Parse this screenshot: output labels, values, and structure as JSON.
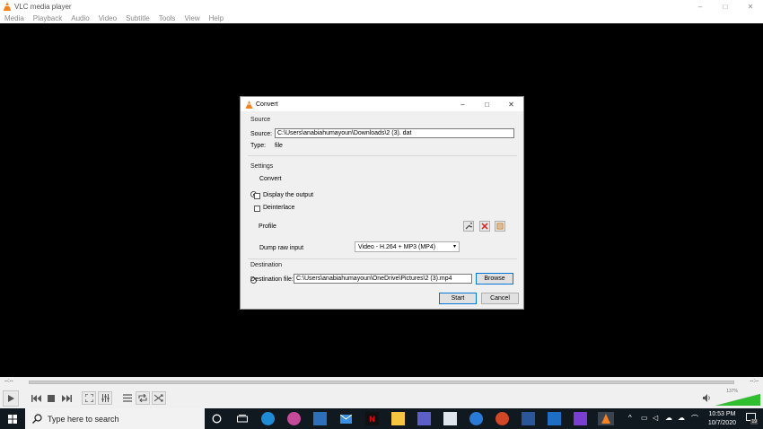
{
  "window": {
    "title": "VLC media player",
    "controls": [
      "–",
      "□",
      "✕"
    ]
  },
  "menu": [
    "Media",
    "Playback",
    "Audio",
    "Video",
    "Subtitle",
    "Tools",
    "View",
    "Help"
  ],
  "dialog": {
    "title": "Convert",
    "controls": [
      "–",
      "□",
      "✕"
    ],
    "source_section": "Source",
    "source_label": "Source:",
    "source_value": "C:\\Users\\anabiahumayoun\\Downloads\\2 (3). dat",
    "type_label": "Type:",
    "type_value": "file",
    "settings_section": "Settings",
    "convert_label": "Convert",
    "display_output_label": "Display the output",
    "deinterlace_label": "Deinterlace",
    "profile_label": "Profile",
    "profile_value": "Video - H.264 + MP3 (MP4)",
    "dump_raw_label": "Dump raw input",
    "destination_section": "Destination",
    "destination_label": "Destination file:",
    "destination_value": "C:\\Users\\anabiahumayoun\\OneDrive\\Pictures\\2 (3).mp4",
    "browse_label": "Browse",
    "start_label": "Start",
    "cancel_label": "Cancel"
  },
  "player": {
    "time_elapsed": "--:--",
    "time_total": "--:--",
    "volume_percent": "137%"
  },
  "taskbar": {
    "search_placeholder": "Type here to search",
    "time": "10:53 PM",
    "date": "10/7/2020",
    "notification_count": "19"
  }
}
